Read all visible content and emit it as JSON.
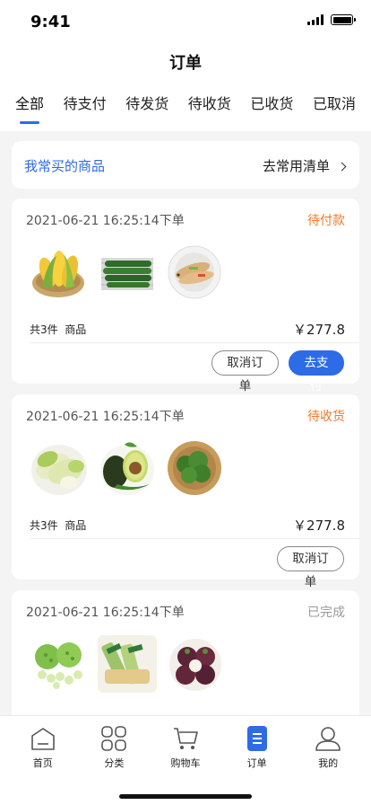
{
  "status_bar": {
    "time": "9:41"
  },
  "header": {
    "title": "订单"
  },
  "tabs": [
    {
      "label": "全部",
      "active": true
    },
    {
      "label": "待支付"
    },
    {
      "label": "待发货"
    },
    {
      "label": "待收货"
    },
    {
      "label": "已收货"
    },
    {
      "label": "已取消"
    }
  ],
  "favorites": {
    "left_label": "我常买的商品",
    "right_label": "去常用清单"
  },
  "orders": [
    {
      "time": "2021-06-21 16:25:14下单",
      "status": "待付款",
      "status_color": "#f07a2c",
      "items": [
        "玉米",
        "黄瓜",
        "鱼"
      ],
      "count": "共3件",
      "goods": "商品",
      "price": "￥277.8",
      "buttons": [
        "取消订单",
        "去支付"
      ]
    },
    {
      "time": "2021-06-21 16:25:14下单",
      "status": "待收货",
      "status_color": "#f07a2c",
      "items": [
        "白菜",
        "牛油果",
        "西兰花"
      ],
      "count": "共3件",
      "goods": "商品",
      "price": "￥277.8",
      "buttons": [
        "取消订单"
      ]
    },
    {
      "time": "2021-06-21 16:25:14下单",
      "status": "已完成",
      "status_color": "#999999",
      "items": [
        "莲蓬",
        "毛豆",
        "山竹"
      ]
    }
  ],
  "bottom_nav": [
    {
      "label": "首页",
      "icon": "home-icon"
    },
    {
      "label": "分类",
      "icon": "category-icon"
    },
    {
      "label": "购物车",
      "icon": "cart-icon"
    },
    {
      "label": "订单",
      "icon": "order-icon",
      "active": true
    },
    {
      "label": "我的",
      "icon": "profile-icon"
    }
  ],
  "colors": {
    "accent": "#2e6be6",
    "warning": "#f07a2c",
    "muted": "#999999"
  }
}
